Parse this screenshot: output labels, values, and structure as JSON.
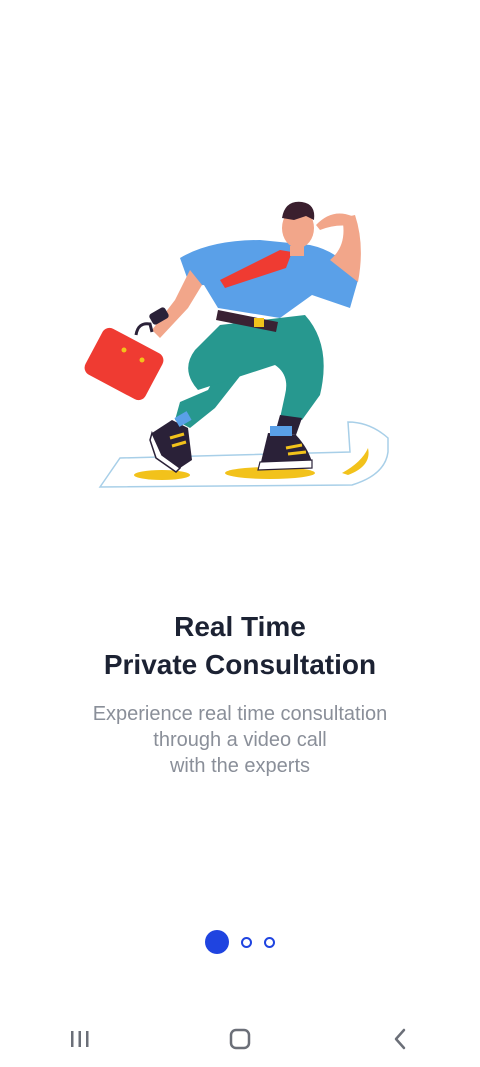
{
  "onboarding": {
    "title_line1": "Real Time",
    "title_line2": "Private Consultation",
    "subtitle_line1": "Experience real time consultation",
    "subtitle_line2": "through a video call",
    "subtitle_line3": "with the experts",
    "illustration": "man-with-briefcase-walking-illustration",
    "current_page": 1,
    "page_count": 3
  },
  "colors": {
    "title": "#1c2233",
    "subtitle": "#8a8f99",
    "accent": "#1f44e0",
    "briefcase": "#ef3b32",
    "shirt": "#5aa0e8",
    "pants": "#27988f",
    "shadow": "#f2c21b"
  },
  "navbar": {
    "recents_icon": "recents-icon",
    "home_icon": "home-icon",
    "back_icon": "back-icon"
  }
}
